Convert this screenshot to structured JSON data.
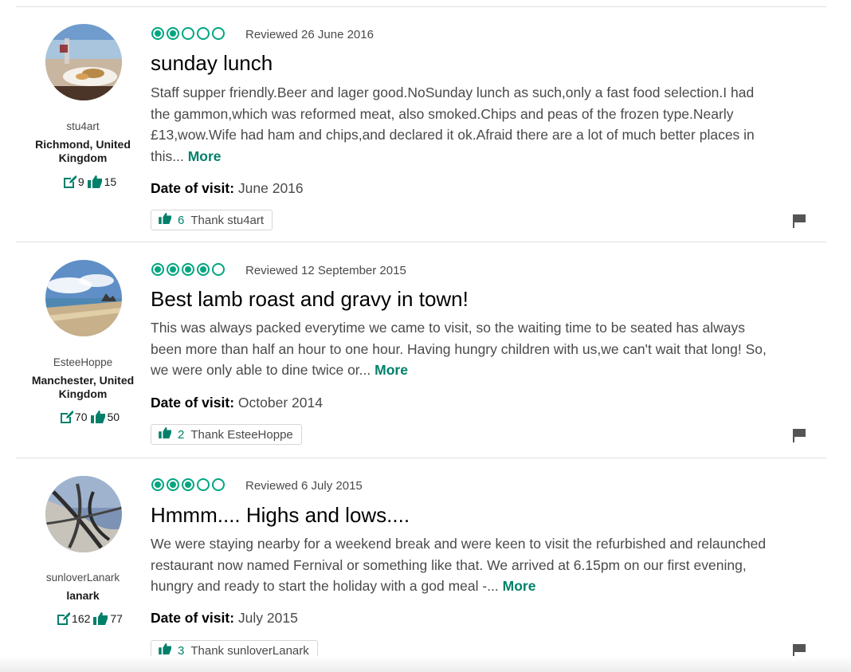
{
  "colors": {
    "accent": "#00a680",
    "link": "#00806a",
    "text": "#4a4a4a"
  },
  "reviews": [
    {
      "user": {
        "name": "stu4art",
        "location": "Richmond, United Kingdom",
        "reviews_count": "9",
        "helpful_count": "15"
      },
      "rating": 2,
      "reviewed_date": "Reviewed 26 June 2016",
      "title": "sunday lunch",
      "text": "Staff supper friendly.Beer and lager good.NoSunday lunch as such,only a fast food selection.I had the gammon,which was reformed meat, also smoked.Chips and peas of the frozen type.Nearly £13,wow.Wife had ham and chips,and declared it ok.Afraid there are a lot of much better places in this...",
      "more_label": "More",
      "date_of_visit_label": "Date of visit:",
      "date_of_visit": "June 2016",
      "thank_count": "6",
      "thank_label": "Thank stu4art"
    },
    {
      "user": {
        "name": "EsteeHoppe",
        "location": "Manchester, United Kingdom",
        "reviews_count": "70",
        "helpful_count": "50"
      },
      "rating": 4,
      "reviewed_date": "Reviewed 12 September 2015",
      "title": "Best lamb roast and gravy in town!",
      "text": "This was always packed everytime we came to visit, so the waiting time to be seated has always been more than half an hour to one hour. Having hungry children with us,we can't wait that long! So, we were only able to dine twice or...",
      "more_label": "More",
      "date_of_visit_label": "Date of visit:",
      "date_of_visit": "October 2014",
      "thank_count": "2",
      "thank_label": "Thank EsteeHoppe"
    },
    {
      "user": {
        "name": "sunloverLanark",
        "location": "lanark",
        "reviews_count": "162",
        "helpful_count": "77"
      },
      "rating": 3,
      "reviewed_date": "Reviewed 6 July 2015",
      "title": "Hmmm.... Highs and lows....",
      "text": "We were staying nearby for a weekend break and were keen to visit the refurbished and relaunched restaurant now named Fernival or something like that. We arrived at 6.15pm on our first evening, hungry and ready to start the holiday with a god meal -...",
      "more_label": "More",
      "date_of_visit_label": "Date of visit:",
      "date_of_visit": "July 2015",
      "thank_count": "3",
      "thank_label": "Thank sunloverLanark"
    }
  ]
}
